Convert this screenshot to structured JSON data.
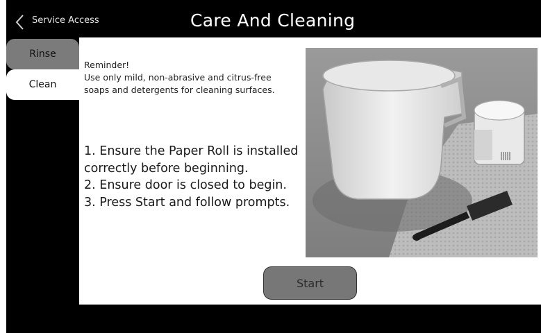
{
  "header": {
    "back_label": "Service Access",
    "title": "Care And Cleaning"
  },
  "sidebar": {
    "items": [
      {
        "label": "Rinse",
        "selected": false
      },
      {
        "label": "Clean",
        "selected": true
      }
    ]
  },
  "main": {
    "reminder": {
      "heading": "Reminder!",
      "line1": "Use only mild, non-abrasive and citrus-free",
      "line2": "soaps and detergents for cleaning surfaces."
    },
    "steps": {
      "line1": "1. Ensure the Paper Roll is installed",
      "line2": "correctly before beginning.",
      "line3": "2. Ensure door is closed to begin.",
      "line4": "3. Press Start and follow prompts."
    },
    "start_label": "Start"
  },
  "colors": {
    "background": "#000000",
    "panel": "#ffffff",
    "tab_inactive": "#7b7b7b",
    "button": "#777777"
  },
  "icons": {
    "back": "chevron-left-icon"
  }
}
